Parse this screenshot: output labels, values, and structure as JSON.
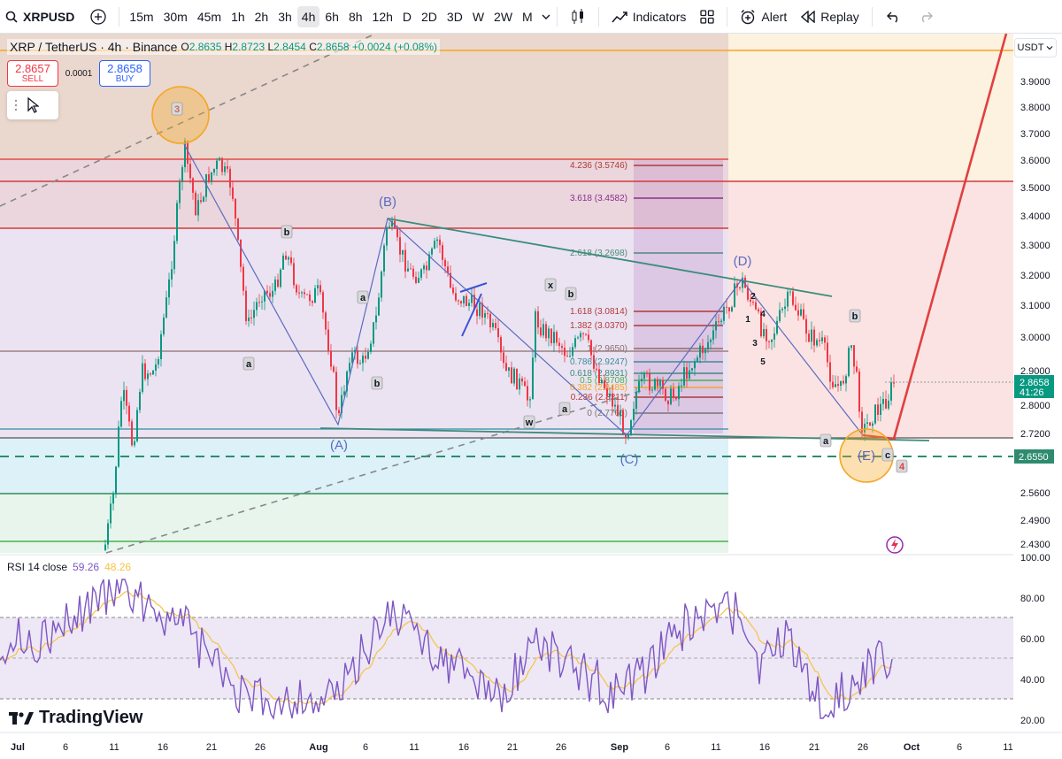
{
  "toolbar": {
    "symbol": "XRPUSD",
    "intervals": [
      "15m",
      "30m",
      "45m",
      "1h",
      "2h",
      "3h",
      "4h",
      "6h",
      "8h",
      "12h",
      "D",
      "2D",
      "3D",
      "W",
      "2W",
      "M"
    ],
    "active_interval": "4h",
    "indicators_label": "Indicators",
    "alert_label": "Alert",
    "replay_label": "Replay"
  },
  "legend": {
    "title": "XRP / TetherUS · 4h · Binance",
    "o_label": "O",
    "o": "2.8635",
    "h_label": "H",
    "h": "2.8723",
    "l_label": "L",
    "l": "2.8454",
    "c_label": "C",
    "c": "2.8658",
    "change": "+0.0024 (+0.08%)"
  },
  "trade": {
    "sell_price": "2.8657",
    "sell_label": "SELL",
    "spread": "0.0001",
    "buy_price": "2.8658",
    "buy_label": "BUY"
  },
  "currency": "USDT",
  "price_axis": [
    "3.9000",
    "3.8000",
    "3.7000",
    "3.6000",
    "3.5000",
    "3.4000",
    "3.3000",
    "3.2000",
    "3.1000",
    "3.0000",
    "2.9000",
    "2.8000",
    "2.7200",
    "2.5600",
    "2.4900",
    "2.4300"
  ],
  "last_price": {
    "price": "2.8658",
    "countdown": "41:26",
    "color": "#089981"
  },
  "dashed_level": {
    "price": "2.6550",
    "color": "#2e8b6e"
  },
  "time_axis": [
    "Jul",
    "6",
    "11",
    "16",
    "21",
    "26",
    "Aug",
    "6",
    "11",
    "16",
    "21",
    "26",
    "Sep",
    "6",
    "11",
    "16",
    "21",
    "26",
    "Oct",
    "6",
    "11"
  ],
  "fib_labels": [
    "4.236 (3.5746)",
    "3.618 (3.4582)",
    "2.618 (3.2698)",
    "1.618 (3.0814)",
    "1.382 (3.0370)",
    "1 (2.9650)",
    "0.786 (2.9247)",
    "0.618 (2.8931)",
    "0.5 (2.8708)",
    "0.382 (2.8485)",
    "0.236 (2.8211)",
    "0 (2.7766)"
  ],
  "wave_labels": [
    "(A)",
    "(B)",
    "(C)",
    "(D)",
    "(E)",
    "3",
    "4",
    "a",
    "b",
    "c",
    "x",
    "w",
    "1",
    "2",
    "5"
  ],
  "rsi": {
    "title": "RSI 14 close",
    "value": "59.26",
    "ma": "48.26",
    "axis": [
      "100.00",
      "80.00",
      "60.00",
      "40.00",
      "20.00"
    ]
  },
  "brand": "TradingView",
  "colors": {
    "up": "#089981",
    "down": "#f23645",
    "accent": "#2962ff",
    "rsi": "#7e57c2",
    "rsi_ma": "#f6c443"
  }
}
